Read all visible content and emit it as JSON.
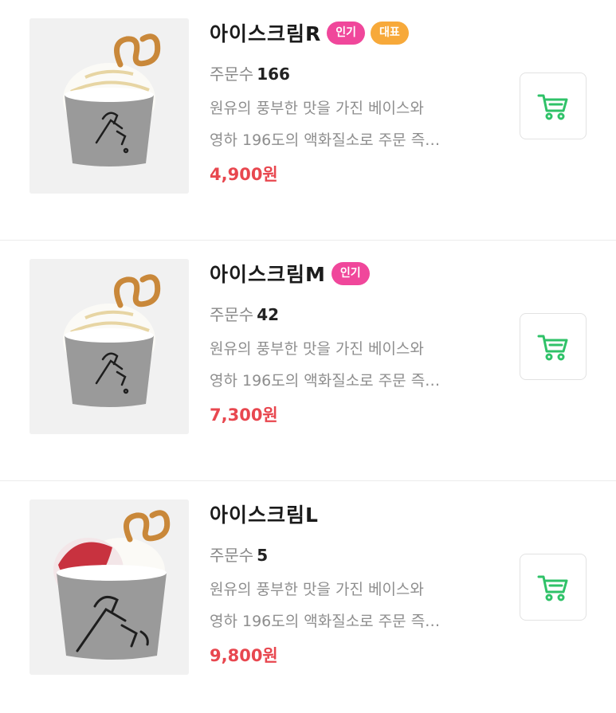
{
  "colors": {
    "accent_green": "#2fc268",
    "price_red": "#e8474f",
    "badge_pink": "#f0479b",
    "badge_orange": "#f7a93a"
  },
  "orders_label": "주문수",
  "items": [
    {
      "name": "아이스크림R",
      "badges": [
        {
          "label": "인기",
          "color": "pink"
        },
        {
          "label": "대표",
          "color": "orange"
        }
      ],
      "orders": "166",
      "desc_line1": "원유의 풍부한 맛을 가진 베이스와",
      "desc_line2": "영하 196도의 액화질소로 주문 즉…",
      "price": "4,900원",
      "image": "ice-cream-cup-pretzel",
      "cart_icon": "cart-icon"
    },
    {
      "name": "아이스크림M",
      "badges": [
        {
          "label": "인기",
          "color": "pink"
        }
      ],
      "orders": "42",
      "desc_line1": "원유의 풍부한 맛을 가진 베이스와",
      "desc_line2": "영하 196도의 액화질소로 주문 즉…",
      "price": "7,300원",
      "image": "ice-cream-cup-pretzel",
      "cart_icon": "cart-icon"
    },
    {
      "name": "아이스크림L",
      "badges": [],
      "orders": "5",
      "desc_line1": "원유의 풍부한 맛을 가진 베이스와",
      "desc_line2": "영하 196도의 액화질소로 주문 즉…",
      "price": "9,800원",
      "image": "ice-cream-cup-strawberry-pretzel",
      "cart_icon": "cart-icon"
    }
  ]
}
